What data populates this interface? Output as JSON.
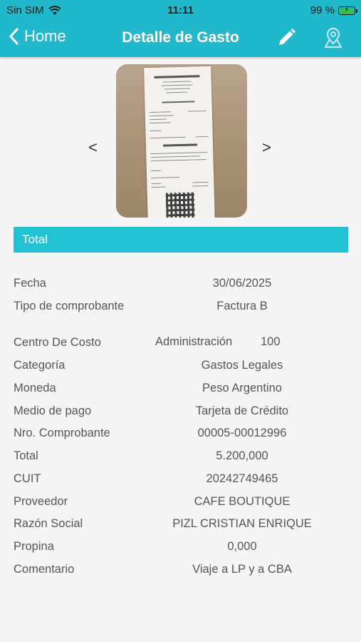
{
  "status_bar": {
    "carrier": "Sin SIM",
    "time": "11:11",
    "battery": "99 %",
    "battery_level": 0.99
  },
  "nav": {
    "back_label": "Home",
    "title": "Detalle de Gasto",
    "edit_icon": "pencil-icon",
    "location_icon": "map-pin-icon"
  },
  "gallery": {
    "prev_label": "<",
    "next_label": ">"
  },
  "section": {
    "title": "Total"
  },
  "details": [
    {
      "label": "Fecha",
      "value": "30/06/2025"
    },
    {
      "label": "Tipo de comprobante",
      "value": "Factura B"
    },
    {
      "label": "Centro De Costo",
      "value": "Administración",
      "value2": "100"
    },
    {
      "label": "Categoría",
      "value": "Gastos Legales"
    },
    {
      "label": "Moneda",
      "value": "Peso Argentino"
    },
    {
      "label": "Medio de pago",
      "value": "Tarjeta de Crédito"
    },
    {
      "label": "Nro. Comprobante",
      "value": "00005-00012996"
    },
    {
      "label": "Total",
      "value": "5.200,000"
    },
    {
      "label": "CUIT",
      "value": "20242749465"
    },
    {
      "label": "Proveedor",
      "value": "CAFE BOUTIQUE"
    },
    {
      "label": "Razón Social",
      "value": "PIZL CRISTIAN ENRIQUE"
    },
    {
      "label": "Propina",
      "value": "0,000"
    },
    {
      "label": "Comentario",
      "value": "Viaje a LP y a CBA"
    }
  ],
  "colors": {
    "header": "#22b8cc",
    "section_bar": "#22c1d3",
    "background": "#f5f5f5"
  }
}
